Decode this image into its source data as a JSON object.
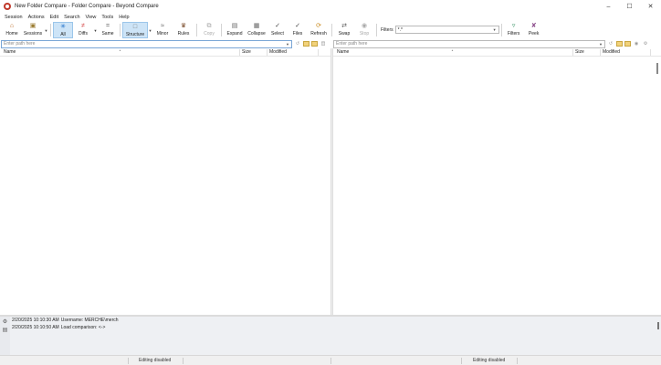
{
  "window": {
    "title": "New Folder Compare - Folder Compare - Beyond Compare",
    "controls": [
      "minimize",
      "maximize",
      "close"
    ]
  },
  "menu": [
    "Session",
    "Actions",
    "Edit",
    "Search",
    "View",
    "Tools",
    "Help"
  ],
  "toolbar": {
    "home": "Home",
    "sessions": "Sessions",
    "all": "All",
    "diffs": "Diffs",
    "same": "Same",
    "structure": "Structure",
    "minor": "Minor",
    "rules": "Rules",
    "copy": "Copy",
    "expand": "Expand",
    "collapse": "Collapse",
    "select": "Select",
    "files": "Files",
    "refresh": "Refresh",
    "swap": "Swap",
    "stop": "Stop",
    "filters_label": "Filters",
    "filters_value": "*.*",
    "filters_btn": "Filters",
    "peek": "Peek"
  },
  "left_pane": {
    "path_placeholder": "Enter path here",
    "columns": [
      "Name",
      "Size",
      "Modified"
    ]
  },
  "right_pane": {
    "path_placeholder": "Enter path here",
    "columns": [
      "Name",
      "Size",
      "Modified"
    ]
  },
  "log": [
    {
      "time": "2/20/2025 10:10:30 AM",
      "message": "Username: MERCHE\\merch"
    },
    {
      "time": "2/20/2025 10:10:50 AM",
      "message": "Load comparison: <->"
    }
  ],
  "status": {
    "left": "Editing disabled",
    "right": "Editing disabled"
  },
  "colors": {
    "active_toolbar": "#cde4f7",
    "path_border": "#7aa6d6",
    "log_background": "#eef0f3"
  }
}
